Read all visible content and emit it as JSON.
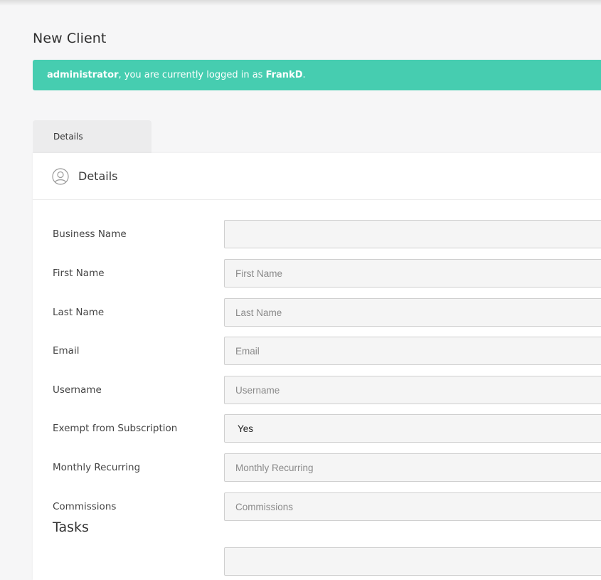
{
  "page": {
    "title": "New Client"
  },
  "banner": {
    "user_role": "administrator",
    "message": ", you are currently logged in as ",
    "username": "FrankD",
    "end": ".",
    "color": "#46cdb0"
  },
  "tabs": [
    {
      "label": "Details",
      "active": true
    }
  ],
  "details": {
    "icon": "user-circle-icon",
    "title": "Details",
    "fields": [
      {
        "label": "Business Name",
        "value": "",
        "placeholder": ""
      },
      {
        "label": "First Name",
        "value": "",
        "placeholder": "First Name"
      },
      {
        "label": "Last Name",
        "value": "",
        "placeholder": "Last Name"
      },
      {
        "label": "Email",
        "value": "",
        "placeholder": "Email"
      },
      {
        "label": "Username",
        "value": "",
        "placeholder": "Username"
      },
      {
        "label": "Exempt from Subscription",
        "value": "Yes",
        "type": "select"
      },
      {
        "label": "Monthly Recurring",
        "value": "",
        "placeholder": "Monthly Recurring"
      },
      {
        "label": "Commissions",
        "value": "",
        "placeholder": "Commissions"
      }
    ]
  },
  "tasks": {
    "title": "Tasks"
  }
}
